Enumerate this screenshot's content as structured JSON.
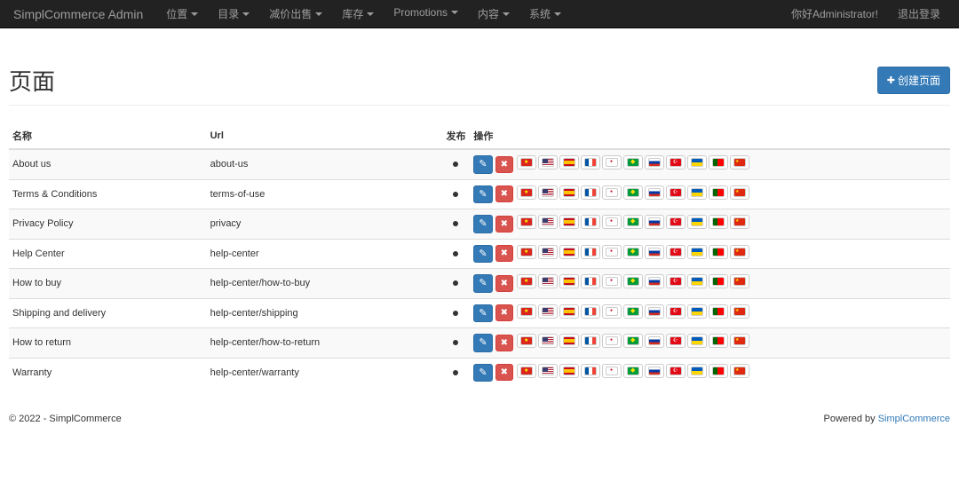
{
  "brand": "SimplCommerce Admin",
  "nav": {
    "left": [
      {
        "label": "位置"
      },
      {
        "label": "目录"
      },
      {
        "label": "减价出售"
      },
      {
        "label": "库存"
      },
      {
        "label": "Promotions"
      },
      {
        "label": "内容"
      },
      {
        "label": "系统"
      }
    ],
    "right": {
      "greeting": "你好Administrator!",
      "logout": "退出登录"
    }
  },
  "page": {
    "title": "页面",
    "create_button": "创建页面"
  },
  "table": {
    "headers": {
      "name": "名称",
      "url": "Url",
      "published": "发布",
      "actions": "操作"
    },
    "rows": [
      {
        "name": "About us",
        "url": "about-us",
        "published": true
      },
      {
        "name": "Terms & Conditions",
        "url": "terms-of-use",
        "published": true
      },
      {
        "name": "Privacy Policy",
        "url": "privacy",
        "published": true
      },
      {
        "name": "Help Center",
        "url": "help-center",
        "published": true
      },
      {
        "name": "How to buy",
        "url": "help-center/how-to-buy",
        "published": true
      },
      {
        "name": "Shipping and delivery",
        "url": "help-center/shipping",
        "published": true
      },
      {
        "name": "How to return",
        "url": "help-center/how-to-return",
        "published": true
      },
      {
        "name": "Warranty",
        "url": "help-center/warranty",
        "published": true
      }
    ],
    "flags": [
      "vn",
      "us",
      "es",
      "fr",
      "kr",
      "br",
      "ru",
      "tr",
      "ua",
      "pt",
      "cn"
    ]
  },
  "footer": {
    "copyright": "© 2022 - SimplCommerce",
    "powered_by": "Powered by",
    "powered_link": "SimplCommerce"
  }
}
